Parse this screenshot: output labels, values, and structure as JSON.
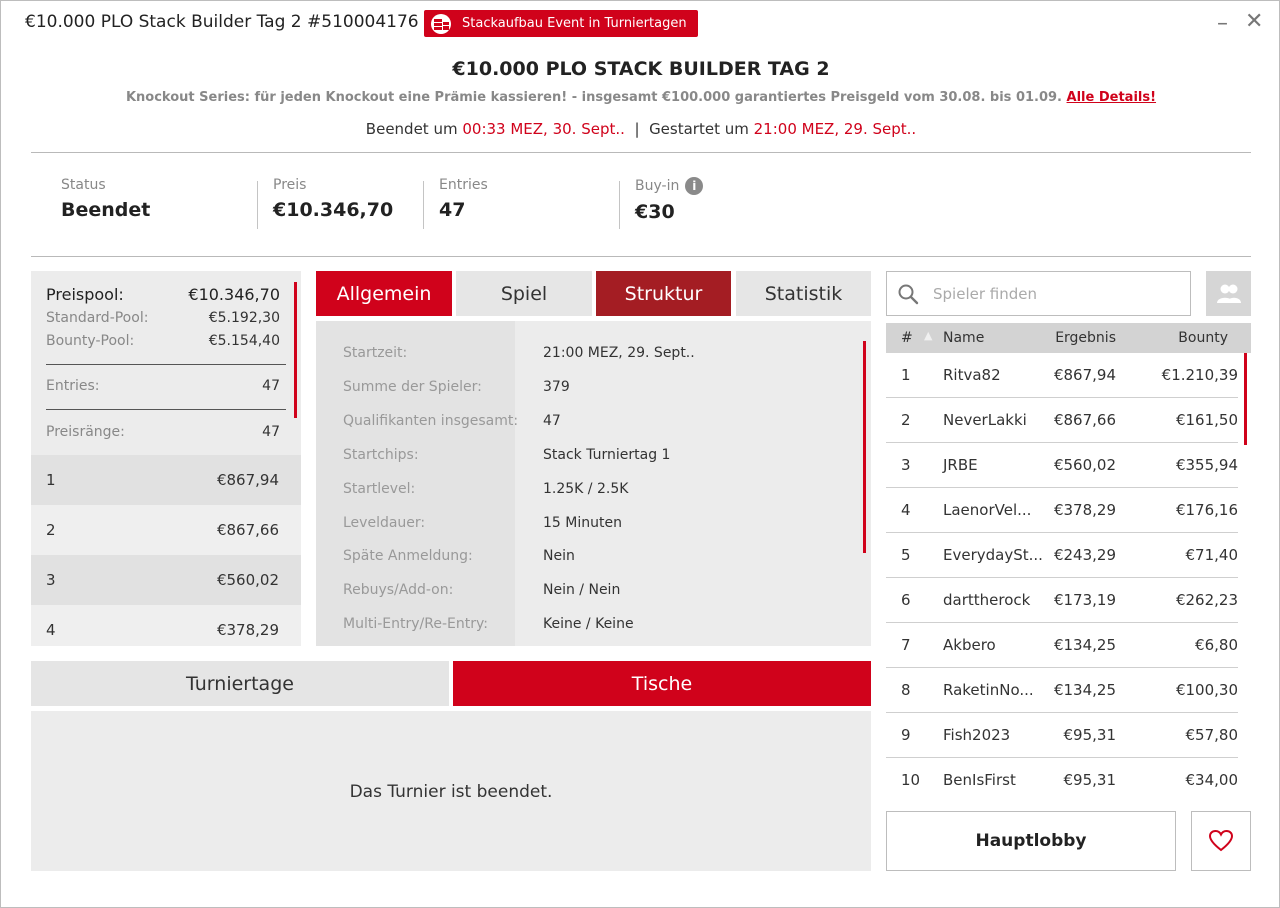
{
  "window": {
    "title": "€10.000 PLO Stack Builder Tag 2 #510004176",
    "badge_label": "Stackaufbau Event in Turniertagen",
    "minimize": "–",
    "close": "✕"
  },
  "header": {
    "title": "€10.000 PLO STACK BUILDER TAG 2",
    "subtitle": "Knockout Series: für jeden Knockout eine Prämie kassieren! - insgesamt €100.000 garantiertes Preisgeld vom 30.08. bis 01.09.",
    "details_link": "Alle Details!",
    "ended_label": "Beendet um",
    "ended_time": "00:33 MEZ, 30. Sept..",
    "separator": "|",
    "started_label": "Gestartet um",
    "started_time": "21:00 MEZ, 29. Sept.."
  },
  "stats": [
    {
      "label": "Status",
      "value": "Beendet"
    },
    {
      "label": "Preis",
      "value": "€10.346,70"
    },
    {
      "label": "Entries",
      "value": "47"
    },
    {
      "label": "Buy-in",
      "value": "€30"
    }
  ],
  "prizepool": {
    "main_label": "Preispool:",
    "main_value": "€10.346,70",
    "standard_label": "Standard-Pool:",
    "standard_value": "€5.192,30",
    "bounty_label": "Bounty-Pool:",
    "bounty_value": "€5.154,40",
    "entries_label": "Entries:",
    "entries_value": "47",
    "ranks_label": "Preisränge:",
    "ranks_value": "47",
    "ranks": [
      {
        "rank": "1",
        "prize": "€867,94"
      },
      {
        "rank": "2",
        "prize": "€867,66"
      },
      {
        "rank": "3",
        "prize": "€560,02"
      },
      {
        "rank": "4",
        "prize": "€378,29"
      }
    ]
  },
  "tabs": [
    "Allgemein",
    "Spiel",
    "Struktur",
    "Statistik"
  ],
  "info_rows": [
    {
      "key": "Startzeit:",
      "value": "21:00 MEZ, 29. Sept.."
    },
    {
      "key": "Summe der Spieler:",
      "value": "379"
    },
    {
      "key": "Qualifikanten insgesamt:",
      "value": "47"
    },
    {
      "key": "Startchips:",
      "value": "Stack Turniertag 1"
    },
    {
      "key": "Startlevel:",
      "value": "1.25K / 2.5K"
    },
    {
      "key": "Leveldauer:",
      "value": "15 Minuten"
    },
    {
      "key": "Späte Anmeldung:",
      "value": "Nein"
    },
    {
      "key": "Rebuys/Add-on:",
      "value": "Nein / Nein"
    },
    {
      "key": "Multi-Entry/Re-Entry:",
      "value": "Keine / Keine"
    }
  ],
  "bottom_tabs": [
    "Turniertage",
    "Tische"
  ],
  "bottom_message": "Das Turnier ist beendet.",
  "search": {
    "placeholder": "Spieler finden"
  },
  "table": {
    "headers": {
      "rank": "#",
      "name": "Name",
      "result": "Ergebnis",
      "bounty": "Bounty"
    },
    "rows": [
      {
        "rank": "1",
        "name": "Ritva82",
        "result": "€867,94",
        "bounty": "€1.210,39"
      },
      {
        "rank": "2",
        "name": "NeverLakki",
        "result": "€867,66",
        "bounty": "€161,50"
      },
      {
        "rank": "3",
        "name": "JRBE",
        "result": "€560,02",
        "bounty": "€355,94"
      },
      {
        "rank": "4",
        "name": "LaenorVel...",
        "result": "€378,29",
        "bounty": "€176,16"
      },
      {
        "rank": "5",
        "name": "EverydaySt...",
        "result": "€243,29",
        "bounty": "€71,40"
      },
      {
        "rank": "6",
        "name": "darttherock",
        "result": "€173,19",
        "bounty": "€262,23"
      },
      {
        "rank": "7",
        "name": "Akbero",
        "result": "€134,25",
        "bounty": "€6,80"
      },
      {
        "rank": "8",
        "name": "RaketinNo...",
        "result": "€134,25",
        "bounty": "€100,30"
      },
      {
        "rank": "9",
        "name": "Fish2023",
        "result": "€95,31",
        "bounty": "€57,80"
      },
      {
        "rank": "10",
        "name": "BenIsFirst",
        "result": "€95,31",
        "bounty": "€34,00"
      }
    ]
  },
  "buttons": {
    "lobby": "Hauptlobby"
  },
  "colors": {
    "accent": "#d0021b",
    "accent_dark": "#a41d23",
    "panel": "#ececec"
  }
}
